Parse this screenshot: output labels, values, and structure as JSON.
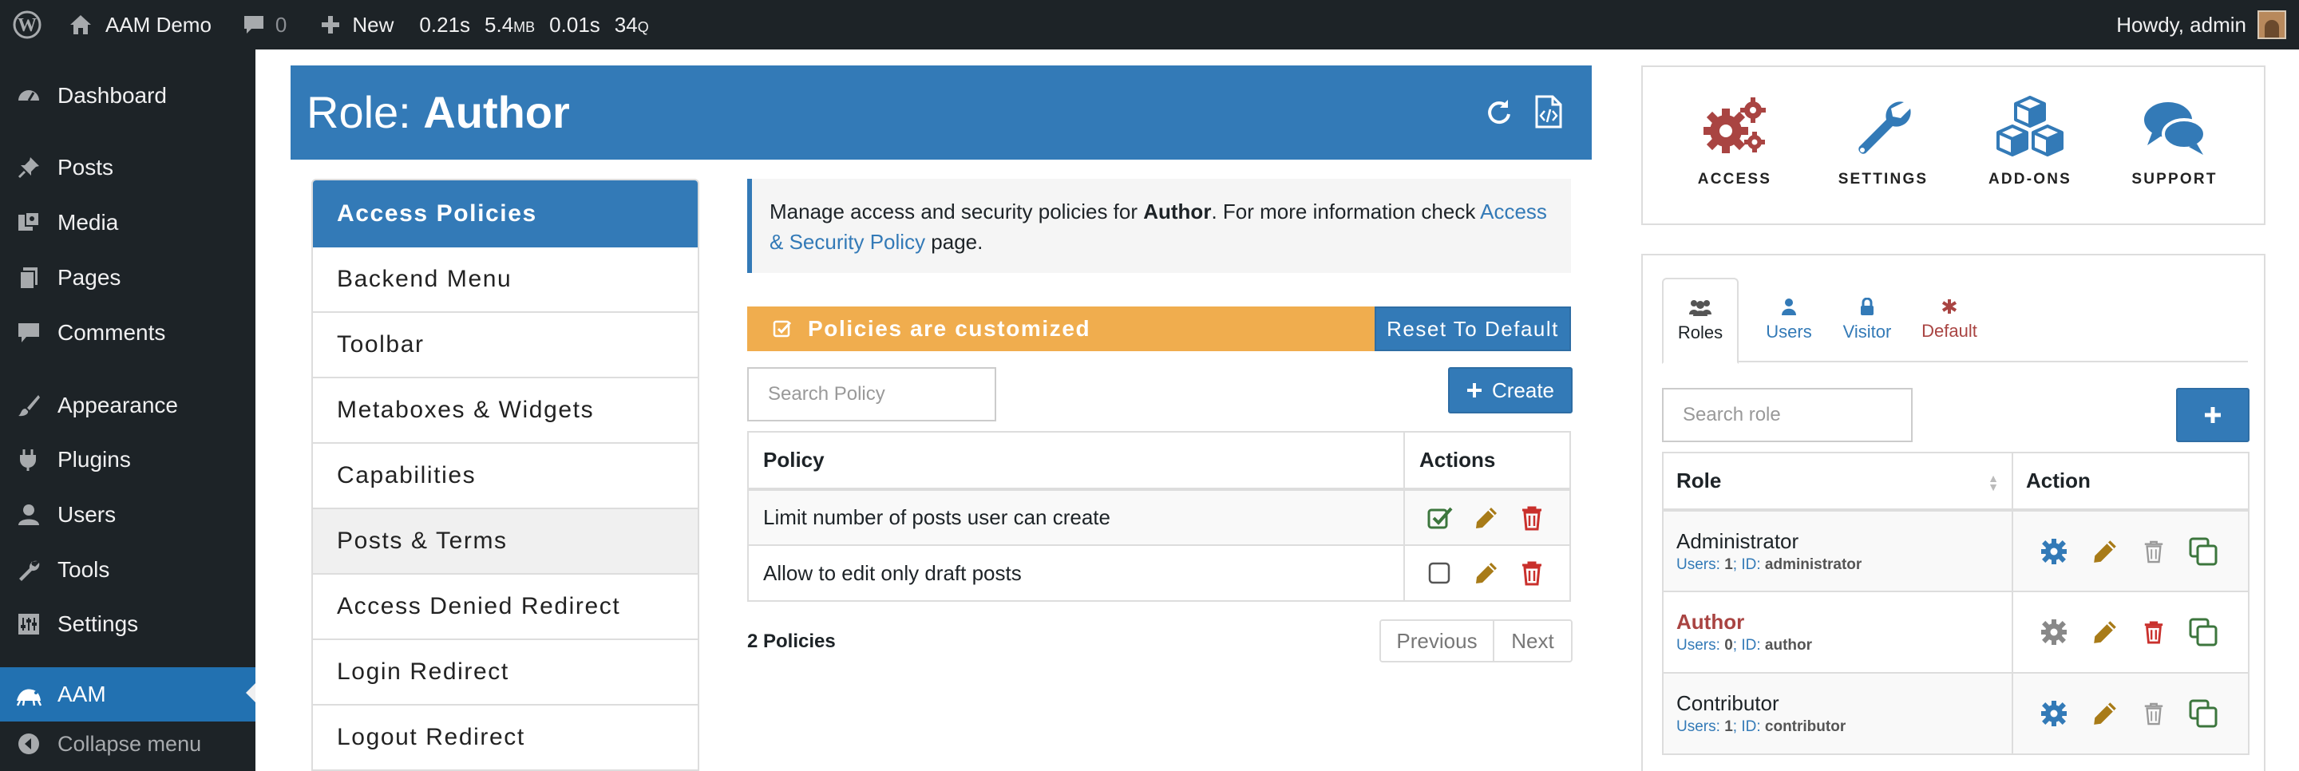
{
  "adminbar": {
    "site_name": "AAM Demo",
    "comments_count": "0",
    "new_label": "New",
    "stats": {
      "time1": "0.21s",
      "mem": "5.4",
      "mem_unit": "MB",
      "time2": "0.01s",
      "queries": "34",
      "queries_unit": "Q"
    },
    "howdy": "Howdy, admin"
  },
  "sidebar": {
    "items": [
      {
        "label": "Dashboard",
        "icon": "dashboard-icon"
      },
      {
        "label": "Posts",
        "icon": "pushpin-icon"
      },
      {
        "label": "Media",
        "icon": "media-icon"
      },
      {
        "label": "Pages",
        "icon": "pages-icon"
      },
      {
        "label": "Comments",
        "icon": "comment-icon"
      },
      {
        "label": "Appearance",
        "icon": "paintbrush-icon"
      },
      {
        "label": "Plugins",
        "icon": "plugin-icon"
      },
      {
        "label": "Users",
        "icon": "user-icon"
      },
      {
        "label": "Tools",
        "icon": "wrench-icon"
      },
      {
        "label": "Settings",
        "icon": "settings-icon"
      },
      {
        "label": "AAM",
        "icon": "aam-icon",
        "active": true
      }
    ],
    "collapse_label": "Collapse menu"
  },
  "role_header": {
    "prefix": "Role: ",
    "role": "Author"
  },
  "tabs": [
    "Access Policies",
    "Backend Menu",
    "Toolbar",
    "Metaboxes & Widgets",
    "Capabilities",
    "Posts & Terms",
    "Access Denied Redirect",
    "Login Redirect",
    "Logout Redirect"
  ],
  "info": {
    "text1": "Manage access and security policies for ",
    "role": "Author",
    "text2": ". For more information check ",
    "link": "Access & Security Policy",
    "text3": " page."
  },
  "policies": {
    "status": "Policies are customized",
    "reset_label": "Reset To Default",
    "search_placeholder": "Search Policy",
    "create_label": "Create",
    "headers": {
      "policy": "Policy",
      "actions": "Actions"
    },
    "rows": [
      {
        "name": "Limit number of posts user can create",
        "attached": true
      },
      {
        "name": "Allow to edit only draft posts",
        "attached": false
      }
    ],
    "count": "2 Policies",
    "prev_label": "Previous",
    "next_label": "Next"
  },
  "top_links": [
    {
      "label": "ACCESS",
      "icon": "gears-icon",
      "color": "#a94442"
    },
    {
      "label": "SETTINGS",
      "icon": "wrench-icon",
      "color": "#337ab7"
    },
    {
      "label": "ADD-ONS",
      "icon": "cubes-icon",
      "color": "#337ab7"
    },
    {
      "label": "SUPPORT",
      "icon": "chat-bubbles-icon",
      "color": "#337ab7"
    }
  ],
  "subject_tabs": [
    {
      "label": "Roles",
      "icon": "users-icon"
    },
    {
      "label": "Users",
      "icon": "user-icon"
    },
    {
      "label": "Visitor",
      "icon": "lock-icon"
    },
    {
      "label": "Default",
      "icon": "asterisk-icon"
    }
  ],
  "roles": {
    "search_placeholder": "Search role",
    "headers": {
      "role": "Role",
      "action": "Action"
    },
    "rows": [
      {
        "name": "Administrator",
        "users_label": "Users:",
        "users": "1",
        "id_label": "ID:",
        "id": "administrator",
        "current": false
      },
      {
        "name": "Author",
        "users_label": "Users:",
        "users": "0",
        "id_label": "ID:",
        "id": "author",
        "current": true
      },
      {
        "name": "Contributor",
        "users_label": "Users:",
        "users": "1",
        "id_label": "ID:",
        "id": "contributor",
        "current": false
      }
    ]
  },
  "colors": {
    "primary": "#337ab7",
    "warning": "#f0ad4e",
    "danger": "#c9302c",
    "success": "#3c763d",
    "edit": "#a87b18",
    "wp_dark": "#1d2327",
    "wp_blue": "#2271b1"
  }
}
